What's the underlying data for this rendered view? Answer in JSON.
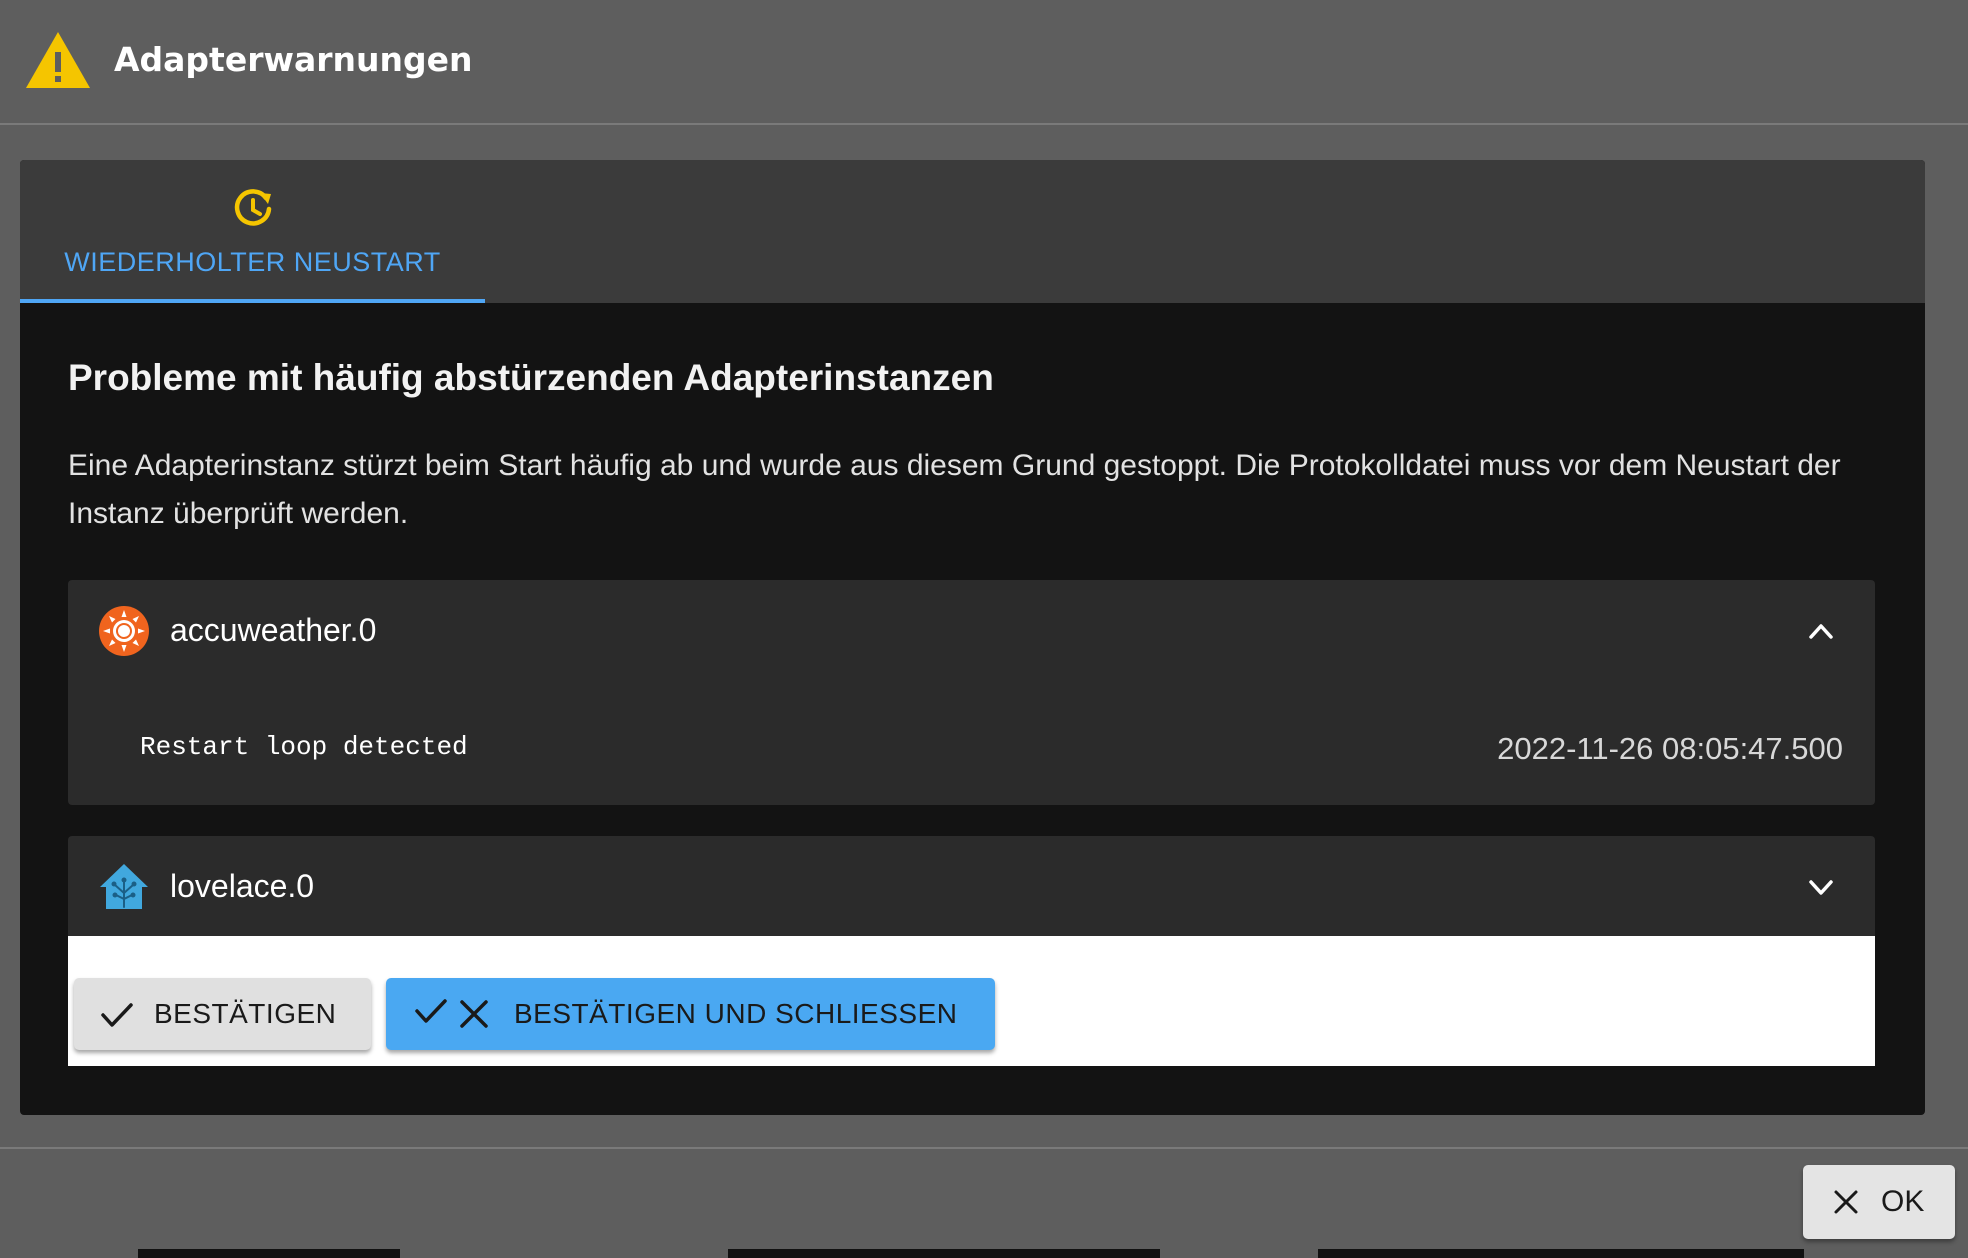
{
  "dialog": {
    "title": "Adapterwarnungen"
  },
  "tabs": [
    {
      "label": "WIEDERHOLTER NEUSTART",
      "icon": "restart-clock-icon",
      "active": true
    }
  ],
  "content": {
    "heading": "Probleme mit häufig abstürzenden Adapterinstanzen",
    "description": "Eine Adapterinstanz stürzt beim Start häufig ab und wurde aus diesem Grund gestoppt. Die Protokolldatei muss vor dem Neustart der Instanz überprüft werden."
  },
  "instances": [
    {
      "name": "accuweather.0",
      "icon": "accuweather-sun-icon",
      "expanded": true,
      "message": "Restart loop detected",
      "timestamp": "2022-11-26 08:05:47.500"
    },
    {
      "name": "lovelace.0",
      "icon": "lovelace-house-icon",
      "expanded": false
    }
  ],
  "actions": {
    "confirm_label": "BESTÄTIGEN",
    "confirm_close_label": "BESTÄTIGEN UND SCHLIESSEN"
  },
  "footer": {
    "ok_label": "OK"
  },
  "colors": {
    "accent": "#4fa6f5",
    "warning": "#f5c500",
    "background": "#5e5e5e",
    "panel": "#131313",
    "accordion": "#2b2b2b"
  }
}
